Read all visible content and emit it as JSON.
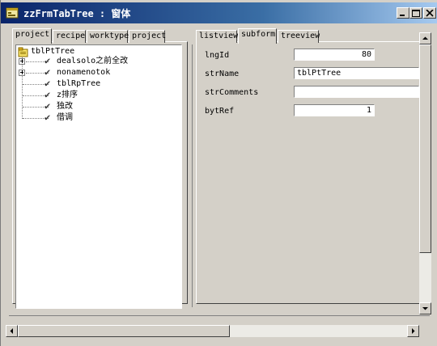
{
  "window": {
    "title": "zzFrmTabTree : 窗体"
  },
  "title_buttons": [
    "minimize",
    "maximize",
    "close"
  ],
  "left_tabs": [
    {
      "label": "project"
    },
    {
      "label": "recipe"
    },
    {
      "label": "worktype"
    },
    {
      "label": "project"
    }
  ],
  "tree": {
    "root": "tblPtTree",
    "children": [
      {
        "label": "dealsolo之前全改",
        "expandable": true
      },
      {
        "label": "nonamenotok",
        "expandable": true
      },
      {
        "label": "tblRpTree",
        "expandable": false
      },
      {
        "label": "z排序",
        "expandable": false
      },
      {
        "label": "独改",
        "expandable": false
      },
      {
        "label": "借调",
        "expandable": false
      }
    ]
  },
  "right_tabs": [
    {
      "label": "listview"
    },
    {
      "label": "subform"
    },
    {
      "label": "treeview"
    }
  ],
  "form": {
    "fields": [
      {
        "label": "lngId",
        "value": "80"
      },
      {
        "label": "strName",
        "value": "tblPtTree"
      },
      {
        "label": "strComments",
        "value": ""
      },
      {
        "label": "bytRef",
        "value": "1"
      }
    ]
  },
  "icons": {
    "window_icon": "form-icon",
    "check_icon": "checkmark-icon",
    "root_icon": "table-icon"
  }
}
